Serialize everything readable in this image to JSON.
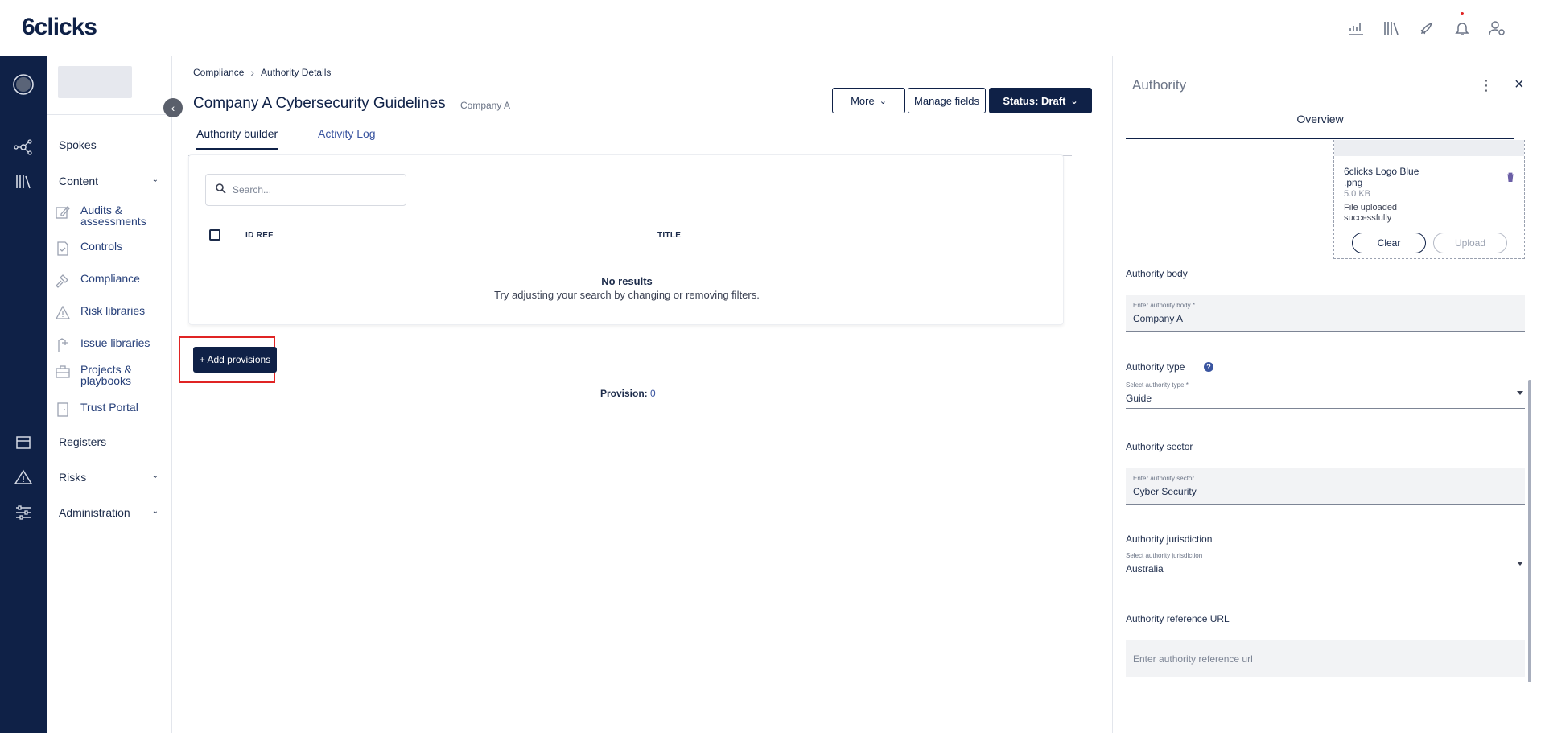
{
  "brand": {
    "logo_text": "6clicks",
    "primary_color": "#0f2147",
    "highlight_color": "#e02424"
  },
  "topbar_icons": [
    "analytics-icon",
    "library-icon",
    "rocket-icon",
    "bell-icon",
    "user-settings-icon"
  ],
  "rail_icons": [
    "user-circle-icon",
    "hub-icon",
    "library-icon",
    "store-icon",
    "warning-icon",
    "sliders-icon"
  ],
  "sidebar": {
    "spokes": "Spokes",
    "content": "Content",
    "content_items": [
      {
        "label": "Audits & assessments",
        "icon": "edit-icon"
      },
      {
        "label": "Controls",
        "icon": "document-check-icon"
      },
      {
        "label": "Compliance",
        "icon": "gavel-icon"
      },
      {
        "label": "Risk libraries",
        "icon": "warning-icon"
      },
      {
        "label": "Issue libraries",
        "icon": "issue-icon"
      },
      {
        "label": "Projects & playbooks",
        "icon": "briefcase-icon"
      },
      {
        "label": "Trust Portal",
        "icon": "portal-icon"
      }
    ],
    "registers": "Registers",
    "risks": "Risks",
    "administration": "Administration"
  },
  "breadcrumb": {
    "items": [
      "Compliance",
      "Authority Details"
    ]
  },
  "header": {
    "title": "Company A Cybersecurity Guidelines",
    "subtitle": "Company A",
    "more_label": "More",
    "manage_fields_label": "Manage fields",
    "status_label": "Status: Draft"
  },
  "tabs": {
    "builder": "Authority builder",
    "activity": "Activity Log"
  },
  "table": {
    "search_placeholder": "Search...",
    "columns": [
      "ID REF",
      "TITLE"
    ],
    "empty_title": "No results",
    "empty_subtitle": "Try adjusting your search by changing or removing filters."
  },
  "add_provisions_label": "+ Add provisions",
  "provision": {
    "label": "Provision:",
    "count": "0"
  },
  "panel": {
    "title": "Authority",
    "tab_overview": "Overview",
    "file": {
      "name": "6clicks Logo Blue .png",
      "size": "5.0 KB",
      "status": "File uploaded successfully",
      "clear_label": "Clear",
      "upload_label": "Upload"
    },
    "authority_body": {
      "label": "Authority body",
      "field_label": "Enter authority body *",
      "value": "Company A"
    },
    "authority_type": {
      "label": "Authority type",
      "field_label": "Select authority type *",
      "value": "Guide"
    },
    "authority_sector": {
      "label": "Authority sector",
      "field_label": "Enter authority sector",
      "value": "Cyber Security"
    },
    "authority_jurisdiction": {
      "label": "Authority jurisdiction",
      "field_label": "Select authority jurisdiction",
      "value": "Australia"
    },
    "authority_url": {
      "label": "Authority reference URL",
      "placeholder": "Enter authority reference url"
    }
  }
}
